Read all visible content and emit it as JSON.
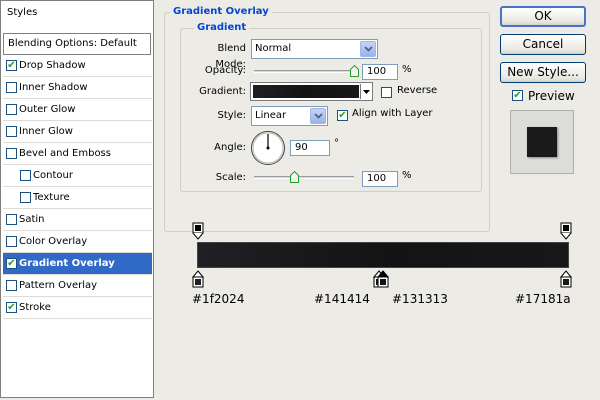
{
  "styles_panel": {
    "header": "Styles",
    "blending": "Blending Options: Default",
    "items": [
      {
        "label": "Drop Shadow",
        "checked": true
      },
      {
        "label": "Inner Shadow",
        "checked": false
      },
      {
        "label": "Outer Glow",
        "checked": false
      },
      {
        "label": "Inner Glow",
        "checked": false
      },
      {
        "label": "Bevel and Emboss",
        "checked": false
      },
      {
        "label": "Contour",
        "checked": false
      },
      {
        "label": "Texture",
        "checked": false
      },
      {
        "label": "Satin",
        "checked": false
      },
      {
        "label": "Color Overlay",
        "checked": false
      },
      {
        "label": "Gradient Overlay",
        "checked": true
      },
      {
        "label": "Pattern Overlay",
        "checked": false
      },
      {
        "label": "Stroke",
        "checked": true
      }
    ],
    "check_glyph": "✔"
  },
  "gradient_overlay": {
    "title": "Gradient Overlay",
    "section": "Gradient",
    "blend_mode_label": "Blend Mode:",
    "blend_mode": "Normal",
    "opacity_label": "Opacity:",
    "opacity": "100",
    "opacity_unit": "%",
    "opacity_level": 1.0,
    "gradient_label": "Gradient:",
    "reverse_label": "Reverse",
    "reverse_checked": false,
    "style_label": "Style:",
    "style": "Linear",
    "align_label": "Align with Layer",
    "align_checked": true,
    "angle_label": "Angle:",
    "angle": "90",
    "angle_unit": "°",
    "scale_label": "Scale:",
    "scale": "100",
    "scale_unit": "%",
    "scale_level": 0.4
  },
  "buttons": {
    "ok": "OK",
    "cancel": "Cancel",
    "new_style": "New Style...",
    "preview_label": "Preview",
    "preview_checked": true
  },
  "gradient_editor": {
    "colors": [
      "#1f2024",
      "#141414",
      "#131313",
      "#17181a"
    ],
    "stop_labels": [
      "#1f2024",
      "#141414",
      "#131313",
      "#17181a"
    ]
  },
  "theme": {
    "accent": "#3169c6",
    "title_blue": "#0046d5",
    "check_green": "#21a121"
  }
}
